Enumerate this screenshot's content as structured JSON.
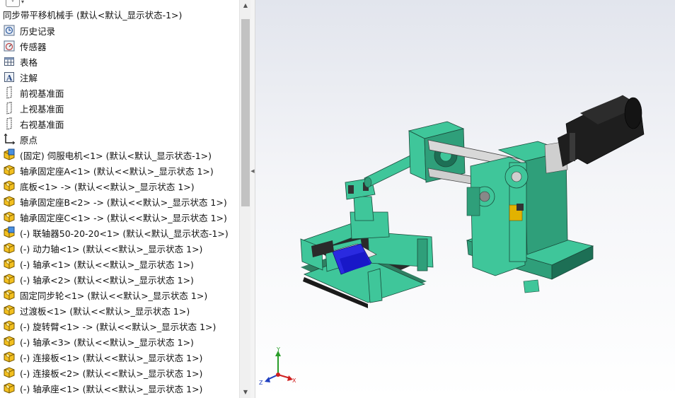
{
  "tree": {
    "root_label": "同步带平移机械手  (默认<默认_显示状态-1>)",
    "items": [
      {
        "label": "历史记录",
        "icon": "history-icon"
      },
      {
        "label": "传感器",
        "icon": "sensor-icon"
      },
      {
        "label": "表格",
        "icon": "table-icon"
      },
      {
        "label": "注解",
        "icon": "annotation-icon"
      },
      {
        "label": "前视基准面",
        "icon": "plane-icon"
      },
      {
        "label": "上视基准面",
        "icon": "plane-icon"
      },
      {
        "label": "右视基准面",
        "icon": "plane-icon"
      },
      {
        "label": "原点",
        "icon": "origin-icon"
      },
      {
        "label": "(固定) 伺服电机<1> (默认<默认_显示状态-1>)",
        "icon": "subassembly-icon"
      },
      {
        "label": "轴承固定座A<1> (默认<<默认>_显示状态 1>)",
        "icon": "part-icon"
      },
      {
        "label": "底板<1> -> (默认<<默认>_显示状态 1>)",
        "icon": "part-icon"
      },
      {
        "label": "轴承固定座B<2> -> (默认<<默认>_显示状态 1>)",
        "icon": "part-icon"
      },
      {
        "label": "轴承固定座C<1> -> (默认<<默认>_显示状态 1>)",
        "icon": "part-icon"
      },
      {
        "label": "(-) 联轴器50-20-20<1> (默认<默认_显示状态-1>)",
        "icon": "subassembly-icon"
      },
      {
        "label": "(-) 动力轴<1> (默认<<默认>_显示状态 1>)",
        "icon": "part-icon"
      },
      {
        "label": "(-) 轴承<1> (默认<<默认>_显示状态 1>)",
        "icon": "part-icon"
      },
      {
        "label": "(-) 轴承<2> (默认<<默认>_显示状态 1>)",
        "icon": "part-icon"
      },
      {
        "label": "固定同步轮<1> (默认<<默认>_显示状态 1>)",
        "icon": "part-icon"
      },
      {
        "label": "过渡板<1> (默认<<默认>_显示状态 1>)",
        "icon": "part-icon"
      },
      {
        "label": "(-) 旋转臂<1> -> (默认<<默认>_显示状态 1>)",
        "icon": "part-icon"
      },
      {
        "label": "(-) 轴承<3> (默认<<默认>_显示状态 1>)",
        "icon": "part-icon"
      },
      {
        "label": "(-) 连接板<1> (默认<<默认>_显示状态 1>)",
        "icon": "part-icon"
      },
      {
        "label": "(-) 连接板<2> (默认<<默认>_显示状态 1>)",
        "icon": "part-icon"
      },
      {
        "label": "(-) 轴承座<1> (默认<<默认>_显示状态 1>)",
        "icon": "part-icon"
      }
    ]
  },
  "triad": {
    "x": "X",
    "y": "Y",
    "z": "Z"
  },
  "colors": {
    "part_green": "#3fc69a",
    "part_dark": "#1f1f1f",
    "part_blue": "#2a2ae0",
    "part_yellow": "#e2b200",
    "axis_x": "#d02020",
    "axis_y": "#2a9d2a",
    "axis_z": "#2040c0"
  }
}
